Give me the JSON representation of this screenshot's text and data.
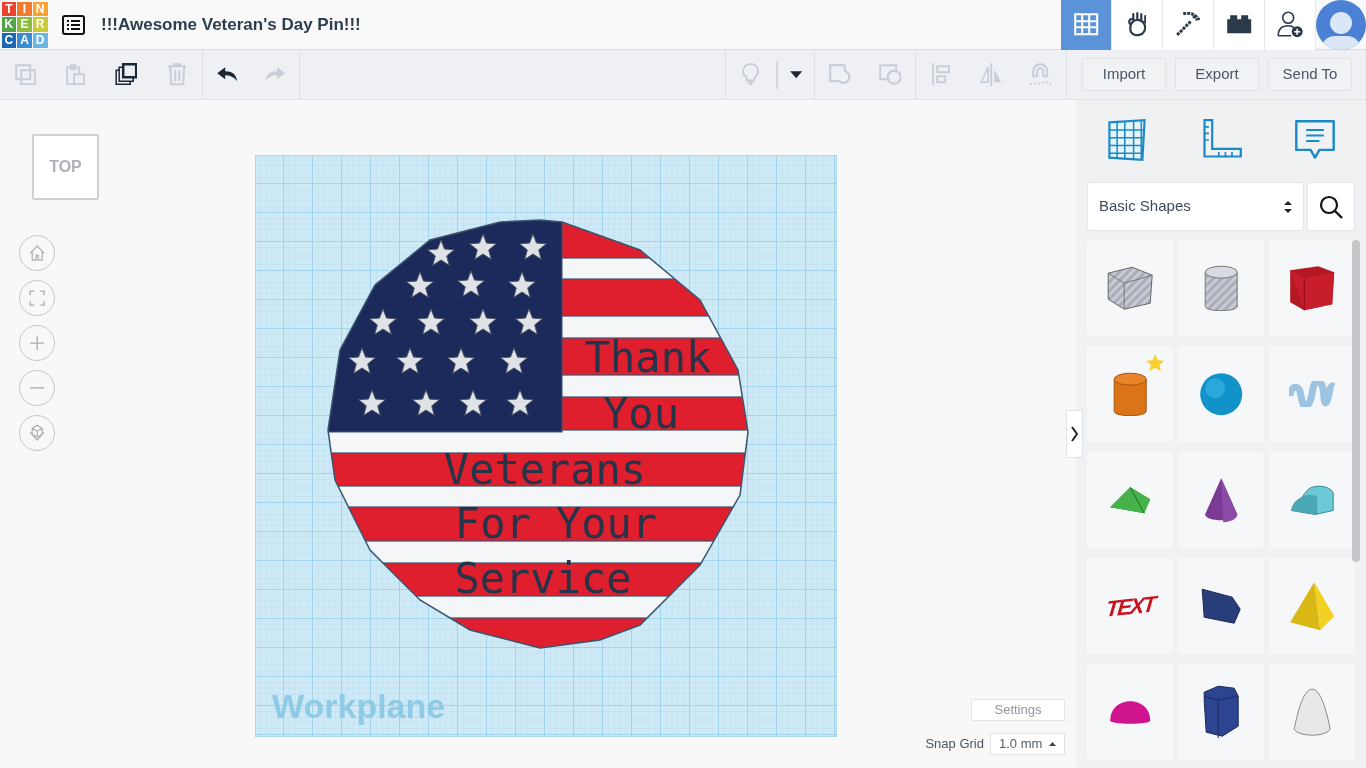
{
  "app": {
    "logo_letters": [
      "T",
      "I",
      "N",
      "K",
      "E",
      "R",
      "C",
      "A",
      "D"
    ],
    "design_title": "!!!Awesome Veteran's Day Pin!!!"
  },
  "modes": [
    {
      "kind": "grid",
      "selected": true
    },
    {
      "kind": "hand",
      "selected": false
    },
    {
      "kind": "pickaxe",
      "selected": false
    },
    {
      "kind": "brick",
      "selected": false
    },
    {
      "kind": "add-user",
      "selected": false
    }
  ],
  "toolbar": {
    "tools": [
      {
        "kind": "copy",
        "disabled": true
      },
      {
        "kind": "paste",
        "disabled": true
      },
      {
        "kind": "duplicate",
        "disabled": false
      },
      {
        "kind": "delete",
        "disabled": true
      },
      {
        "kind": "undo",
        "disabled": false
      },
      {
        "kind": "redo",
        "disabled": true
      }
    ],
    "view_tools": [
      {
        "kind": "bulb",
        "disabled": true
      },
      {
        "kind": "caret",
        "disabled": false
      },
      {
        "kind": "group",
        "disabled": true
      },
      {
        "kind": "ungroup",
        "disabled": true
      },
      {
        "kind": "align",
        "disabled": true
      },
      {
        "kind": "mirror",
        "disabled": true
      },
      {
        "kind": "magnet",
        "disabled": true
      }
    ],
    "actions": [
      "Import",
      "Export",
      "Send To"
    ]
  },
  "view_cube": {
    "label": "TOP"
  },
  "view_controls": [
    {
      "kind": "home"
    },
    {
      "kind": "fit"
    },
    {
      "kind": "zoom-in"
    },
    {
      "kind": "zoom-out"
    },
    {
      "kind": "perspective"
    }
  ],
  "workplane": {
    "label": "Workplane",
    "design_texts": [
      "Thank",
      "You",
      "Veterans",
      "For Your",
      "Service"
    ]
  },
  "settings_button": "Settings",
  "snap_grid": {
    "label": "Snap Grid",
    "value": "1.0 mm"
  },
  "panel": {
    "tools": [
      {
        "kind": "workplane"
      },
      {
        "kind": "ruler"
      },
      {
        "kind": "notes"
      }
    ],
    "category": "Basic Shapes",
    "shapes": [
      {
        "kind": "box-hole",
        "starred": false
      },
      {
        "kind": "cylinder-hole",
        "starred": false
      },
      {
        "kind": "box",
        "starred": false
      },
      {
        "kind": "cylinder",
        "starred": true
      },
      {
        "kind": "sphere",
        "starred": false
      },
      {
        "kind": "scribble",
        "starred": false
      },
      {
        "kind": "roof",
        "starred": false
      },
      {
        "kind": "cone",
        "starred": false
      },
      {
        "kind": "round-roof",
        "starred": false
      },
      {
        "kind": "text",
        "label": "TEXT",
        "starred": false
      },
      {
        "kind": "prism",
        "starred": false
      },
      {
        "kind": "pyramid",
        "starred": false
      },
      {
        "kind": "half-sphere",
        "starred": false
      },
      {
        "kind": "hexagonal-prism",
        "starred": false
      },
      {
        "kind": "paraboloid",
        "starred": false
      }
    ]
  }
}
